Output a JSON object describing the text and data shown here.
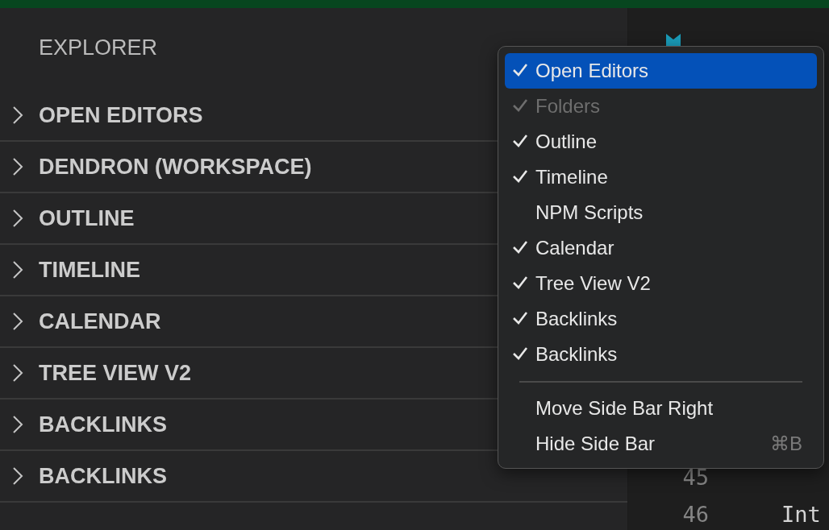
{
  "sidebar": {
    "title": "EXPLORER",
    "sections": [
      {
        "label": "OPEN EDITORS",
        "expanded": false
      },
      {
        "label": "DENDRON (WORKSPACE)",
        "expanded": false
      },
      {
        "label": "OUTLINE",
        "expanded": false
      },
      {
        "label": "TIMELINE",
        "expanded": false
      },
      {
        "label": "CALENDAR",
        "expanded": false
      },
      {
        "label": "TREE VIEW V2",
        "expanded": false
      },
      {
        "label": "BACKLINKS",
        "expanded": false
      },
      {
        "label": "BACKLINKS",
        "expanded": false
      }
    ]
  },
  "editor": {
    "lines": [
      {
        "number": "45"
      },
      {
        "number": "46",
        "text": "Int"
      }
    ]
  },
  "context_menu": {
    "view_items": [
      {
        "label": "Open Editors",
        "checked": true,
        "disabled": false,
        "selected": true
      },
      {
        "label": "Folders",
        "checked": true,
        "disabled": true,
        "selected": false
      },
      {
        "label": "Outline",
        "checked": true,
        "disabled": false,
        "selected": false
      },
      {
        "label": "Timeline",
        "checked": true,
        "disabled": false,
        "selected": false
      },
      {
        "label": "NPM Scripts",
        "checked": false,
        "disabled": false,
        "selected": false
      },
      {
        "label": "Calendar",
        "checked": true,
        "disabled": false,
        "selected": false
      },
      {
        "label": "Tree View V2",
        "checked": true,
        "disabled": false,
        "selected": false
      },
      {
        "label": "Backlinks",
        "checked": true,
        "disabled": false,
        "selected": false
      },
      {
        "label": "Backlinks",
        "checked": true,
        "disabled": false,
        "selected": false
      }
    ],
    "action_items": [
      {
        "label": "Move Side Bar Right",
        "selected": false
      },
      {
        "label": "Hide Side Bar",
        "shortcut": "⌘B",
        "selected": false
      }
    ]
  }
}
